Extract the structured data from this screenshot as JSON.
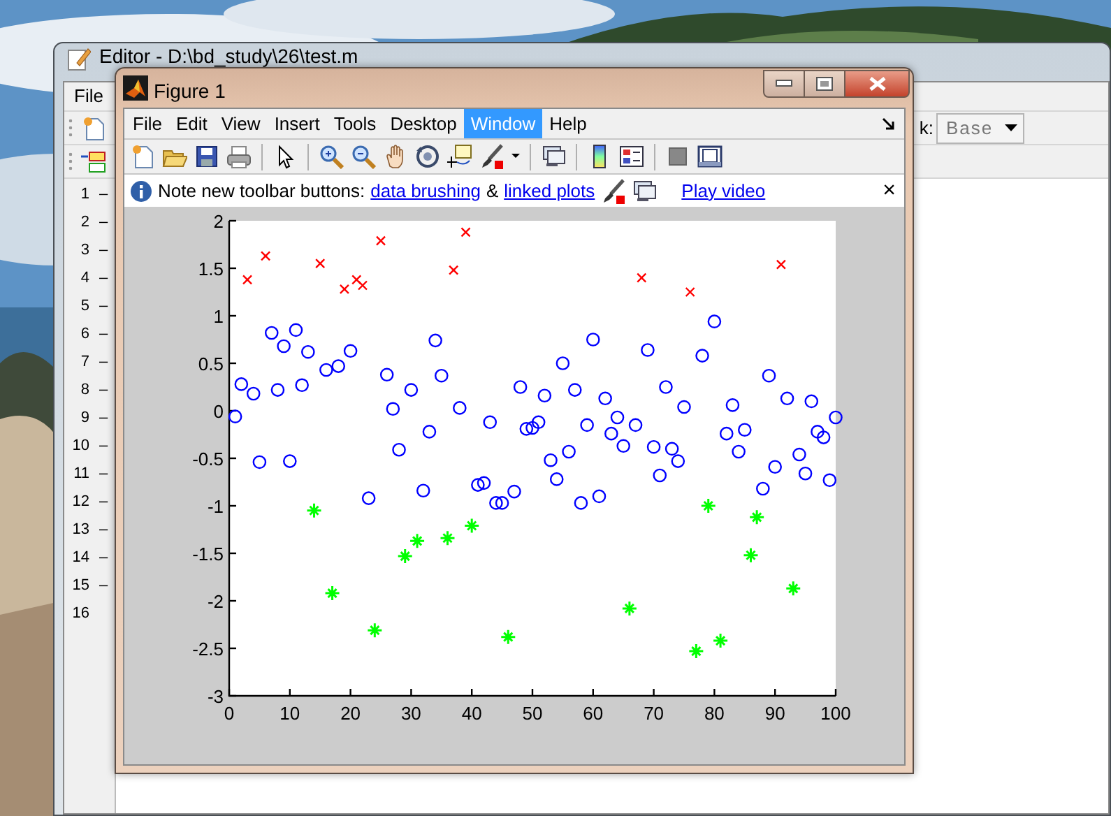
{
  "editor": {
    "title": "Editor - D:\\bd_study\\26\\test.m",
    "menus": [
      "File"
    ],
    "stack_label": "k:",
    "stack_value": "Base",
    "lines": [
      {
        "number": "1",
        "mark": "–"
      },
      {
        "number": "2",
        "mark": "–"
      },
      {
        "number": "3",
        "mark": "–"
      },
      {
        "number": "4",
        "mark": "–"
      },
      {
        "number": "5",
        "mark": "–"
      },
      {
        "number": "6",
        "mark": "–"
      },
      {
        "number": "7",
        "mark": "–"
      },
      {
        "number": "8",
        "mark": "–"
      },
      {
        "number": "9",
        "mark": "–"
      },
      {
        "number": "10",
        "mark": "–"
      },
      {
        "number": "11",
        "mark": "–"
      },
      {
        "number": "12",
        "mark": "–"
      },
      {
        "number": "13",
        "mark": "–"
      },
      {
        "number": "14",
        "mark": "–"
      },
      {
        "number": "15",
        "mark": "–"
      },
      {
        "number": "16"
      }
    ]
  },
  "figure": {
    "title": "Figure 1",
    "menus": [
      {
        "label": "File",
        "selected": false
      },
      {
        "label": "Edit",
        "selected": false
      },
      {
        "label": "View",
        "selected": false
      },
      {
        "label": "Insert",
        "selected": false
      },
      {
        "label": "Tools",
        "selected": false
      },
      {
        "label": "Desktop",
        "selected": false
      },
      {
        "label": "Window",
        "selected": true
      },
      {
        "label": "Help",
        "selected": false
      }
    ],
    "info_bar": {
      "text": "Note new toolbar buttons:",
      "brushing_link": "data brushing",
      "separator": "&",
      "linked_link": "linked plots",
      "video_link": "Play video",
      "close": "×"
    },
    "chart_data": {
      "type": "scatter",
      "x": [
        1,
        2,
        3,
        4,
        5,
        6,
        7,
        8,
        9,
        10,
        11,
        12,
        13,
        14,
        15,
        16,
        17,
        18,
        19,
        20,
        21,
        22,
        23,
        24,
        25,
        26,
        27,
        28,
        29,
        30,
        31,
        32,
        33,
        34,
        35,
        36,
        37,
        38,
        39,
        40,
        41,
        42,
        43,
        44,
        45,
        46,
        47,
        48,
        49,
        50,
        51,
        52,
        53,
        54,
        55,
        56,
        57,
        58,
        59,
        60,
        61,
        62,
        63,
        64,
        65,
        66,
        67,
        68,
        69,
        70,
        71,
        72,
        73,
        74,
        75,
        76,
        77,
        78,
        79,
        80,
        81,
        82,
        83,
        84,
        85,
        86,
        87,
        88,
        89,
        90,
        91,
        92,
        93,
        94,
        95,
        96,
        97,
        98,
        99,
        100
      ],
      "series": [
        {
          "color": "#0000ff",
          "values": [
            -0.06,
            0.28,
            null,
            0.18,
            -0.54,
            null,
            0.82,
            0.22,
            0.68,
            -0.53,
            0.85,
            0.27,
            0.62,
            null,
            null,
            0.43,
            null,
            0.47,
            null,
            0.63,
            null,
            null,
            -0.92,
            null,
            null,
            0.38,
            0.02,
            -0.41,
            null,
            0.22,
            null,
            -0.84,
            -0.22,
            0.74,
            0.37,
            null,
            null,
            0.03,
            null,
            null,
            -0.78,
            -0.76,
            -0.12,
            -0.97,
            -0.97,
            null,
            -0.85,
            0.25,
            -0.19,
            -0.18,
            -0.12,
            0.16,
            -0.52,
            -0.72,
            0.5,
            -0.43,
            0.22,
            -0.97,
            -0.15,
            0.75,
            -0.9,
            0.13,
            -0.24,
            -0.07,
            -0.37,
            null,
            -0.15,
            null,
            0.64,
            -0.38,
            -0.68,
            0.25,
            -0.4,
            -0.53,
            0.04,
            null,
            null,
            0.58,
            null,
            0.94,
            null,
            -0.24,
            0.06,
            -0.43,
            -0.2,
            null,
            null,
            -0.82,
            0.37,
            -0.59,
            null,
            0.13,
            null,
            -0.46,
            -0.66,
            0.1,
            -0.22,
            -0.28,
            -0.73,
            -0.07
          ]
        },
        {
          "color": "#ff0000",
          "values": [
            null,
            null,
            1.38,
            null,
            null,
            1.63,
            null,
            null,
            null,
            null,
            null,
            null,
            null,
            null,
            1.55,
            null,
            null,
            null,
            1.28,
            null,
            1.38,
            1.32,
            null,
            null,
            1.79,
            null,
            null,
            null,
            null,
            null,
            null,
            null,
            null,
            null,
            null,
            null,
            1.48,
            null,
            1.88,
            null,
            null,
            null,
            null,
            null,
            null,
            null,
            null,
            null,
            null,
            null,
            null,
            null,
            null,
            null,
            null,
            null,
            null,
            null,
            null,
            null,
            null,
            null,
            null,
            null,
            null,
            null,
            null,
            1.4,
            null,
            null,
            null,
            null,
            null,
            null,
            null,
            1.25,
            null,
            null,
            null,
            null,
            null,
            null,
            null,
            null,
            null,
            null,
            null,
            null,
            null,
            null,
            1.54,
            null,
            null,
            null,
            null,
            null,
            null,
            null,
            null,
            null
          ]
        },
        {
          "color": "#00ff00",
          "values": [
            null,
            null,
            null,
            null,
            null,
            null,
            null,
            null,
            null,
            null,
            null,
            null,
            null,
            -1.05,
            null,
            null,
            -1.92,
            null,
            null,
            null,
            null,
            null,
            null,
            -2.31,
            null,
            null,
            null,
            null,
            -1.53,
            null,
            -1.37,
            null,
            null,
            null,
            null,
            -1.34,
            null,
            null,
            null,
            -1.21,
            null,
            null,
            null,
            null,
            null,
            -2.38,
            null,
            null,
            null,
            null,
            null,
            null,
            null,
            null,
            null,
            null,
            null,
            null,
            null,
            null,
            null,
            null,
            null,
            null,
            null,
            -2.08,
            null,
            null,
            null,
            null,
            null,
            null,
            null,
            null,
            null,
            null,
            -2.53,
            null,
            -1.0,
            null,
            -2.42,
            null,
            null,
            null,
            null,
            -1.52,
            -1.12,
            null,
            null,
            null,
            null,
            null,
            -1.87,
            null,
            null,
            null,
            null,
            null,
            null,
            null
          ]
        }
      ],
      "xlim": [
        0,
        100
      ],
      "ylim": [
        -3,
        2
      ],
      "xticks": [
        0,
        10,
        20,
        30,
        40,
        50,
        60,
        70,
        80,
        90,
        100
      ],
      "yticks": [
        -3,
        -2.5,
        -2,
        -1.5,
        -1,
        -0.5,
        0,
        0.5,
        1,
        1.5,
        2
      ]
    }
  }
}
